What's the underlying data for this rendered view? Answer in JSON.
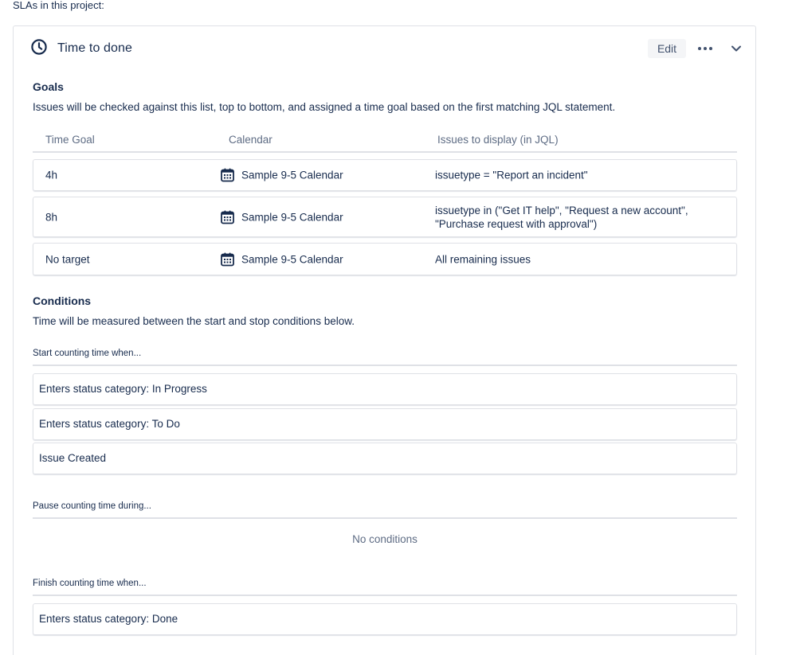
{
  "page": {
    "intro": "SLAs in this project:"
  },
  "sla": {
    "title": "Time to done",
    "edit_label": "Edit",
    "icons": {
      "title": "clock-icon",
      "more": "more-icon",
      "collapse": "chevron-down-icon",
      "calendar": "calendar-icon"
    },
    "goals": {
      "title": "Goals",
      "description": "Issues will be checked against this list, top to bottom, and assigned a time goal based on the first matching JQL statement.",
      "columns": {
        "time_goal": "Time Goal",
        "calendar": "Calendar",
        "issues": "Issues to display (in JQL)"
      },
      "rows": [
        {
          "goal": "4h",
          "calendar": "Sample 9-5 Calendar",
          "jql": "issuetype = \"Report an incident\""
        },
        {
          "goal": "8h",
          "calendar": "Sample 9-5 Calendar",
          "jql": "issuetype in (\"Get IT help\", \"Request a new account\", \"Purchase request with approval\")"
        },
        {
          "goal": "No target",
          "calendar": "Sample 9-5 Calendar",
          "jql": "All remaining issues"
        }
      ]
    },
    "conditions": {
      "title": "Conditions",
      "description": "Time will be measured between the start and stop conditions below.",
      "start": {
        "label": "Start counting time when...",
        "items": [
          "Enters status category: In Progress",
          "Enters status category: To Do",
          "Issue Created"
        ]
      },
      "pause": {
        "label": "Pause counting time during...",
        "empty_text": "No conditions"
      },
      "finish": {
        "label": "Finish counting time when...",
        "items": [
          "Enters status category: Done"
        ]
      }
    },
    "colors": {
      "text": "#172b4d",
      "subtle": "#5e6c84",
      "border": "#dfe1e6",
      "button_bg": "#f4f5f7"
    }
  }
}
